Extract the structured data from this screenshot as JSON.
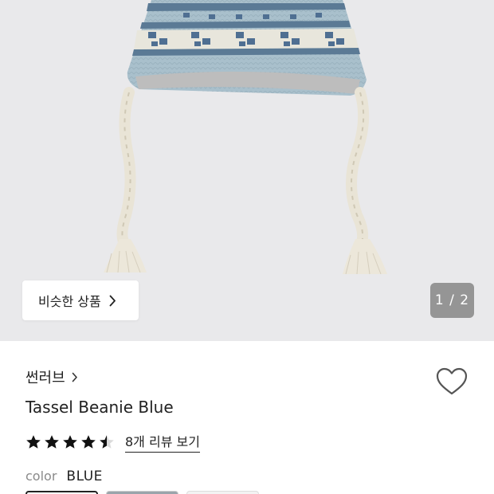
{
  "gallery": {
    "similar_button_label": "비슷한 상품",
    "page_indicator": "1 / 2",
    "image": "beanie-photo"
  },
  "product": {
    "brand": "썬러브",
    "name": "Tassel Beanie Blue",
    "rating": 4.5,
    "rating_max": 5,
    "review_link": "8개 리뷰 보기",
    "color_label": "color",
    "color_value": "BLUE"
  },
  "colors": {
    "background": "#e9e9eb",
    "text": "#222222",
    "muted": "#8a8a8a",
    "indicator_bg": "#787878"
  },
  "icons": {
    "wish": "heart-icon",
    "brand_arrow": "chevron-right-icon",
    "star": "star-icon"
  }
}
